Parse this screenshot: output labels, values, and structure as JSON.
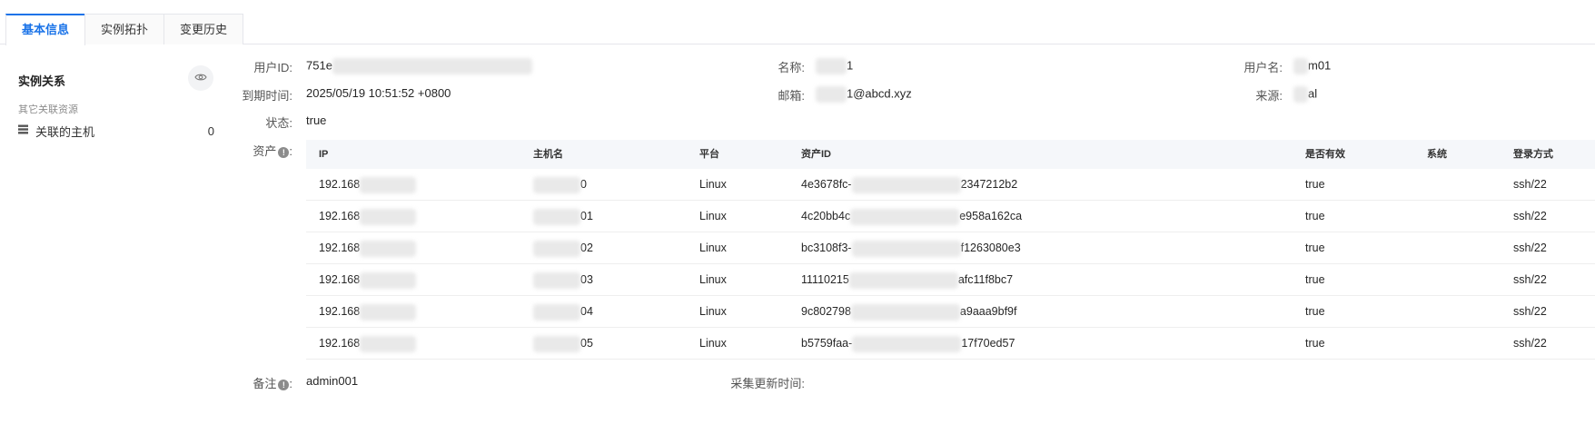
{
  "tabs": [
    {
      "label": "基本信息",
      "active": true
    },
    {
      "label": "实例拓扑",
      "active": false
    },
    {
      "label": "变更历史",
      "active": false
    }
  ],
  "sidebar": {
    "title": "实例关系",
    "section_label": "其它关联资源",
    "items": [
      {
        "label": "关联的主机",
        "count": "0",
        "icon": "list-icon"
      }
    ],
    "eye_icon": "eye-icon"
  },
  "fields": {
    "user_id": {
      "label": "用户ID:",
      "value_prefix": "751e"
    },
    "name": {
      "label": "名称:",
      "value_suffix": "1"
    },
    "username": {
      "label": "用户名:",
      "value_suffix": "m01"
    },
    "expire_time": {
      "label": "到期时间:",
      "value": "2025/05/19 10:51:52 +0800"
    },
    "email": {
      "label": "邮箱:",
      "value_suffix": "1@abcd.xyz"
    },
    "source": {
      "label": "来源:",
      "value_suffix": "al"
    },
    "status": {
      "label": "状态:",
      "value": "true"
    },
    "assets": {
      "label": "资产"
    },
    "remark": {
      "label": "备注",
      "value": "admin001"
    },
    "collect_time": {
      "label": "采集更新时间:",
      "value": ""
    }
  },
  "assets_table": {
    "columns": [
      "IP",
      "主机名",
      "平台",
      "资产ID",
      "是否有效",
      "系统",
      "登录方式"
    ],
    "rows": [
      {
        "ip": "192.168",
        "host_suffix": "0",
        "platform": "Linux",
        "aid_prefix": "4e3678fc-",
        "aid_suffix": "2347212b2",
        "valid": "true",
        "system": "",
        "login": "ssh/22"
      },
      {
        "ip": "192.168",
        "host_suffix": "01",
        "platform": "Linux",
        "aid_prefix": "4c20bb4c",
        "aid_suffix": "e958a162ca",
        "valid": "true",
        "system": "",
        "login": "ssh/22"
      },
      {
        "ip": "192.168",
        "host_suffix": "02",
        "platform": "Linux",
        "aid_prefix": "bc3108f3-",
        "aid_suffix": "f1263080e3",
        "valid": "true",
        "system": "",
        "login": "ssh/22"
      },
      {
        "ip": "192.168",
        "host_suffix": "03",
        "platform": "Linux",
        "aid_prefix": "11110215",
        "aid_suffix": "afc11f8bc7",
        "valid": "true",
        "system": "",
        "login": "ssh/22"
      },
      {
        "ip": "192.168",
        "host_suffix": "04",
        "platform": "Linux",
        "aid_prefix": "9c802798",
        "aid_suffix": "a9aaa9bf9f",
        "valid": "true",
        "system": "",
        "login": "ssh/22"
      },
      {
        "ip": "192.168",
        "host_suffix": "05",
        "platform": "Linux",
        "aid_prefix": "b5759faa-",
        "aid_suffix": "17f70ed57",
        "valid": "true",
        "system": "",
        "login": "ssh/22"
      }
    ]
  },
  "colors": {
    "accent": "#1a73e8",
    "text": "#262626",
    "muted": "#8c8c8c",
    "header_bg": "#f5f7fa"
  }
}
